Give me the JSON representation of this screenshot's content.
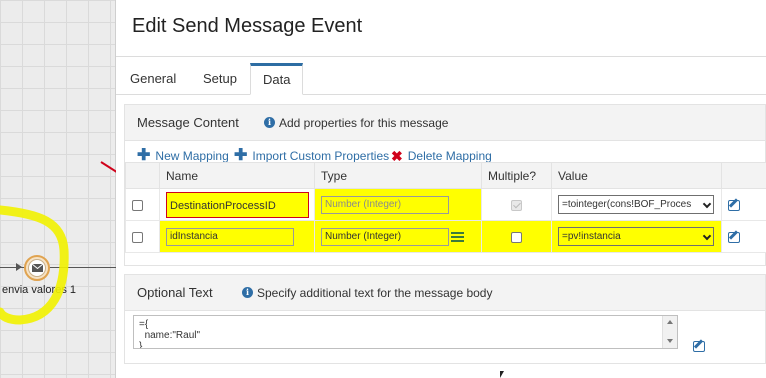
{
  "canvas": {
    "node_label": "envia valores 1",
    "node_icon": "envelope-icon"
  },
  "panel": {
    "title": "Edit Send Message Event"
  },
  "tabs": [
    {
      "label": "General",
      "active": false
    },
    {
      "label": "Setup",
      "active": false
    },
    {
      "label": "Data",
      "active": true
    }
  ],
  "message_content": {
    "title": "Message Content",
    "info": "Add properties for this message",
    "toolbar": {
      "new_mapping": "New Mapping",
      "import_custom": "Import Custom Properties",
      "delete_mapping": "Delete Mapping"
    },
    "columns": [
      "",
      "Name",
      "Type",
      "Multiple?",
      "Value",
      ""
    ],
    "rows": [
      {
        "name": "DestinationProcessID",
        "type_placeholder": "Number (Integer)",
        "multiple_checked": true,
        "multiple_disabled": true,
        "value": "=tointeger(cons!BOF_Proces"
      },
      {
        "name": "idInstancia",
        "type": "Number (Integer)",
        "multiple_checked": false,
        "multiple_disabled": false,
        "value": "=pv!instancia"
      }
    ]
  },
  "optional_text": {
    "title": "Optional Text",
    "info": "Specify additional text for the message body",
    "body": "={\n  name:\"Raul\"\n}"
  },
  "colors": {
    "accent": "#2f6ea6",
    "highlight": "#ffff00",
    "annotation": "#d0021b"
  }
}
